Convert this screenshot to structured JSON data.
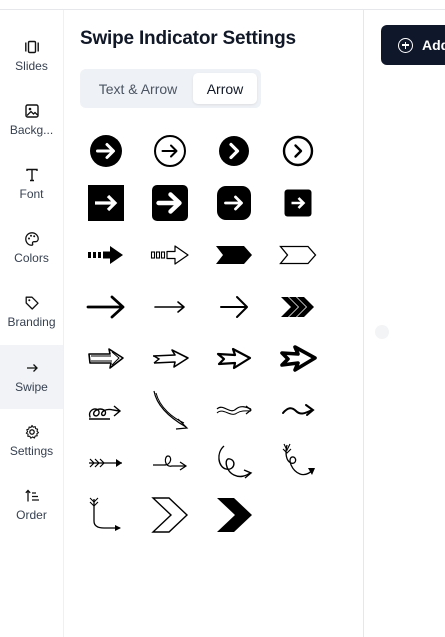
{
  "sidebar": {
    "items": [
      {
        "label": "Slides",
        "icon": "slides-icon"
      },
      {
        "label": "Backg...",
        "icon": "image-icon"
      },
      {
        "label": "Font",
        "icon": "font-icon"
      },
      {
        "label": "Colors",
        "icon": "palette-icon"
      },
      {
        "label": "Branding",
        "icon": "tag-icon"
      },
      {
        "label": "Swipe",
        "icon": "arrow-right-icon",
        "active": true
      },
      {
        "label": "Settings",
        "icon": "gear-icon"
      },
      {
        "label": "Order",
        "icon": "sort-order-icon"
      }
    ]
  },
  "panel": {
    "title": "Swipe Indicator Settings",
    "tabs": [
      {
        "label": "Text & Arrow",
        "selected": false
      },
      {
        "label": "Arrow",
        "selected": true
      }
    ]
  },
  "toolbar": {
    "add_label": "Add",
    "accent_color": "#0f172a"
  },
  "arrow_styles": [
    "circle-filled-arrow",
    "circle-outline-arrow",
    "circle-filled-chevron",
    "circle-outline-chevron",
    "square-filled-arrow",
    "rounded-square-bold-arrow",
    "rounded-square-arrow",
    "small-square-arrow",
    "dashed-tail-arrow",
    "outline-dashed-tail-arrow",
    "chevron-banner",
    "outline-chevron-banner",
    "bold-line-arrow",
    "thin-line-arrow",
    "open-head-arrow",
    "triple-chevron",
    "sketch-block-arrow",
    "sketch-arrow",
    "sketch-hollow-arrow",
    "sketch-bold-arrow",
    "loop-arrow",
    "curved-down-arrow",
    "wavy-arrow",
    "squiggle-arrow",
    "feathered-arrow",
    "loop-line-arrow",
    "spiral-arrow",
    "curly-down-arrow",
    "hook-arrow",
    "outline-chevron",
    "filled-chevron"
  ]
}
